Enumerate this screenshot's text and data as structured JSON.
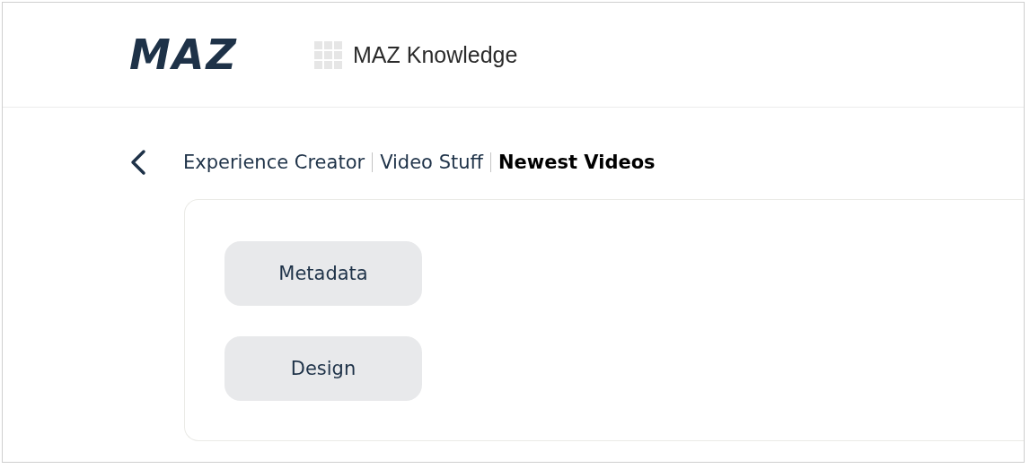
{
  "header": {
    "logo": "MAZ",
    "app_name": "MAZ Knowledge"
  },
  "breadcrumb": [
    {
      "label": "Experience Creator",
      "current": false
    },
    {
      "label": "Video Stuff",
      "current": false
    },
    {
      "label": "Newest Videos",
      "current": true
    }
  ],
  "buttons": [
    "Metadata",
    "Design"
  ]
}
